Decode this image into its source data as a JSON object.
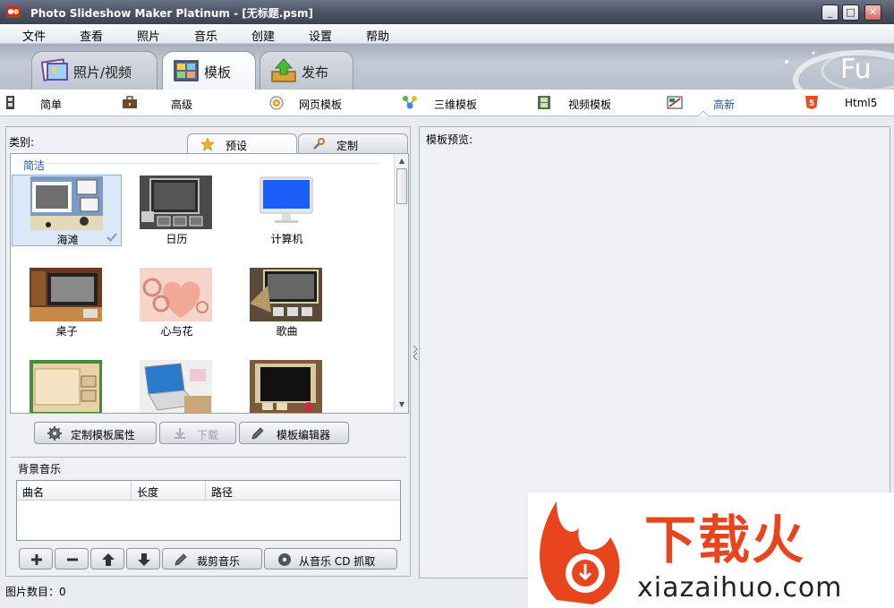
{
  "window": {
    "title": "Photo Slideshow Maker Platinum - [无标题.psm]",
    "minimize": "_",
    "maximize": "□",
    "close": "✕"
  },
  "menu": [
    "文件",
    "查看",
    "照片",
    "音乐",
    "创建",
    "设置",
    "帮助"
  ],
  "main_tabs": [
    {
      "label": "照片/视频",
      "icon": "photos-icon"
    },
    {
      "label": "模板",
      "icon": "template-icon",
      "active": true
    },
    {
      "label": "发布",
      "icon": "publish-icon"
    }
  ],
  "template_nav": [
    {
      "label": "简单",
      "icon": "film-strip-icon"
    },
    {
      "label": "高级",
      "icon": "briefcase-icon"
    },
    {
      "label": "网页模板",
      "icon": "web-icon"
    },
    {
      "label": "三维模板",
      "icon": "3d-molecule-icon"
    },
    {
      "label": "视频模板",
      "icon": "film-icon"
    },
    {
      "label": "高新",
      "icon": "hd-icon",
      "active": true
    },
    {
      "label": "Html5",
      "icon": "html5-icon"
    }
  ],
  "left": {
    "category_label": "类别:",
    "tabs": [
      {
        "label": "预设",
        "icon": "star-icon",
        "active": true
      },
      {
        "label": "定制",
        "icon": "wrench-icon"
      }
    ],
    "group_label": "简洁",
    "templates": [
      {
        "name": "海滩",
        "selected": true
      },
      {
        "name": "日历"
      },
      {
        "name": "计算机"
      },
      {
        "name": "桌子"
      },
      {
        "name": "心与花"
      },
      {
        "name": "歌曲"
      },
      {
        "name": ""
      },
      {
        "name": ""
      },
      {
        "name": ""
      }
    ],
    "buttons": {
      "customize": "定制模板属性",
      "download": "下载",
      "editor": "模板编辑器"
    },
    "music": {
      "title": "背景音乐",
      "columns": [
        "曲名",
        "长度",
        "路径"
      ],
      "trim": "裁剪音乐",
      "rip": "从音乐 CD 抓取"
    }
  },
  "right": {
    "preview_label": "模板预览:"
  },
  "status": {
    "text": "图片数目：0"
  },
  "watermark": {
    "text": "下载火",
    "domain": "xiazaihuo.com"
  },
  "colors": {
    "accent": "#1b55a8",
    "watermark": "#e8451e"
  }
}
